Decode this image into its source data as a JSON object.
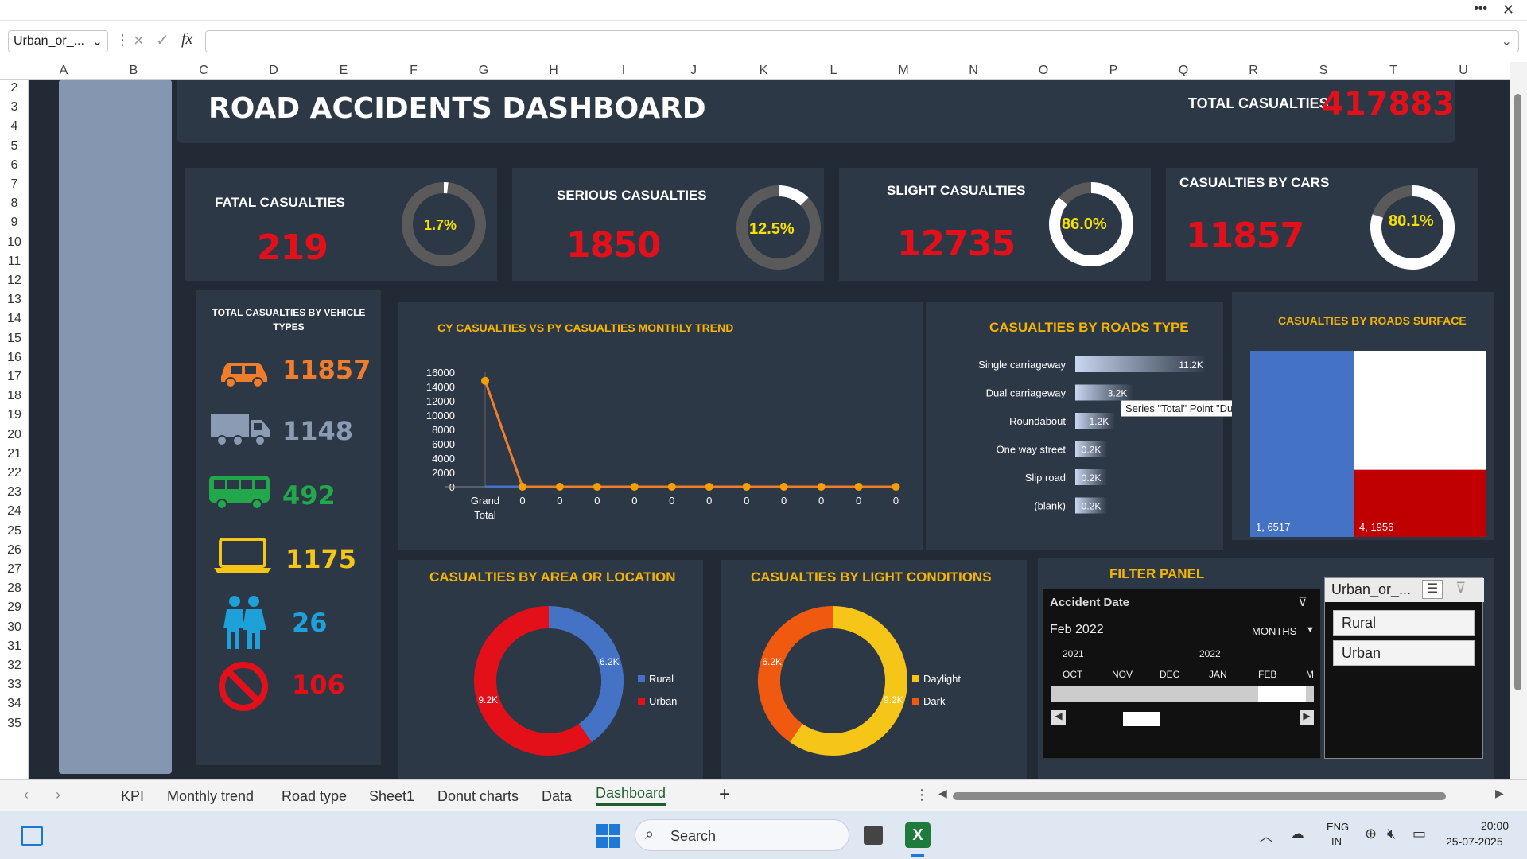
{
  "window": {
    "more": "•••",
    "close": "✕"
  },
  "formula": {
    "namebox": "Urban_or_...",
    "fx": "fx"
  },
  "columns": [
    "A",
    "B",
    "C",
    "D",
    "E",
    "F",
    "G",
    "H",
    "I",
    "J",
    "K",
    "L",
    "M",
    "N",
    "O",
    "P",
    "Q",
    "R",
    "S",
    "T",
    "U"
  ],
  "rows": [
    "2",
    "3",
    "4",
    "5",
    "6",
    "7",
    "8",
    "9",
    "10",
    "11",
    "12",
    "13",
    "14",
    "15",
    "16",
    "17",
    "18",
    "19",
    "20",
    "21",
    "22",
    "23",
    "24",
    "25",
    "26",
    "27",
    "28",
    "29",
    "30",
    "31",
    "32",
    "33",
    "34",
    "35"
  ],
  "header": {
    "title": "ROAD ACCIDENTS DASHBOARD",
    "total_label": "TOTAL CASUALTIES",
    "total_value": "417883"
  },
  "kpis": [
    {
      "title": "FATAL CASUALTIES",
      "value": "219",
      "pct_label": "1.7%",
      "pct": 0.017
    },
    {
      "title": "SERIOUS CASUALTIES",
      "value": "1850",
      "pct_label": "12.5%",
      "pct": 0.125
    },
    {
      "title": "SLIGHT CASUALTIES",
      "value": "12735",
      "pct_label": "86.0%",
      "pct": 0.86
    },
    {
      "title": "CASUALTIES BY CARS",
      "value": "11857",
      "pct_label": "80.1%",
      "pct": 0.801
    }
  ],
  "vehicles": {
    "title": "TOTAL CASUALTIES BY VEHICLE TYPES",
    "items": [
      {
        "icon": "car-icon",
        "value": "11857",
        "color": "#f07d2b"
      },
      {
        "icon": "truck-icon",
        "value": "1148",
        "color": "#8a9bb3"
      },
      {
        "icon": "bus-icon",
        "value": "492",
        "color": "#22a84a"
      },
      {
        "icon": "laptop-icon",
        "value": "1175",
        "color": "#f5c518"
      },
      {
        "icon": "people-icon",
        "value": "26",
        "color": "#1ea0d8"
      },
      {
        "icon": "no-entry-icon",
        "value": "106",
        "color": "#e3101a"
      }
    ]
  },
  "trend_chart": {
    "title": "CY CASUALTIES VS PY CASUALTIES MONTHLY TREND",
    "chart_data": {
      "type": "line",
      "categories": [
        "Grand Total",
        "0",
        "0",
        "0",
        "0",
        "0",
        "0",
        "0",
        "0",
        "0",
        "0",
        "0"
      ],
      "series": [
        {
          "values": [
            14800,
            0,
            0,
            0,
            0,
            0,
            0,
            0,
            0,
            0,
            0,
            0
          ]
        }
      ],
      "yticks": [
        "16000",
        "14000",
        "12000",
        "10000",
        "8000",
        "6000",
        "4000",
        "2000",
        "0"
      ],
      "ylim": [
        0,
        16000
      ]
    }
  },
  "road_type": {
    "title": "CASUALTIES  BY ROADS TYPE",
    "chart_data": {
      "type": "bar",
      "categories": [
        "Single carriageway",
        "Dual carriageway",
        "Roundabout",
        "One way street",
        "Slip road",
        "(blank)"
      ],
      "values": [
        11200,
        3200,
        1200,
        200,
        200,
        200
      ],
      "labels": [
        "11.2K",
        "3.2K",
        "1.2K",
        "0.2K",
        "0.2K",
        "0.2K"
      ]
    },
    "tooltip": "Series \"Total\" Point \"Dual carriageway\" Data Label"
  },
  "road_surface": {
    "title": "CASUALTIES  BY ROADS SURFACE",
    "chart_data": {
      "type": "bar",
      "series": [
        {
          "label": "1, 6517",
          "value": 6517,
          "color": "#4472c4"
        },
        {
          "label": "4, 1956",
          "value": 1956,
          "color": "#c00000"
        }
      ]
    }
  },
  "area_chart": {
    "title": "CASUALTIES  BY AREA OR LOCATION",
    "chart_data": {
      "type": "pie",
      "slices": [
        {
          "name": "Rural",
          "value": 6.2,
          "label": "6.2K",
          "color": "#4472c4"
        },
        {
          "name": "Urban",
          "value": 9.2,
          "label": "9.2K",
          "color": "#e3101a"
        }
      ]
    }
  },
  "light_chart": {
    "title": "CASUALTIES  BY LIGHT CONDITIONS",
    "chart_data": {
      "type": "pie",
      "slices": [
        {
          "name": "Daylight",
          "value": 9.2,
          "label": "9.2K",
          "color": "#f5c518"
        },
        {
          "name": "Dark",
          "value": 6.2,
          "label": "6.2K",
          "color": "#f05a10"
        }
      ]
    }
  },
  "filter": {
    "title": "FILTER PANEL",
    "timeline": {
      "header": "Accident Date",
      "selected": "Feb 2022",
      "level": "MONTHS",
      "years": [
        "2021",
        "2022"
      ],
      "months": [
        "OCT",
        "NOV",
        "DEC",
        "JAN",
        "FEB",
        "M"
      ]
    },
    "slicer": {
      "header": "Urban_or_...",
      "items": [
        "Rural",
        "Urban"
      ]
    }
  },
  "tabs": [
    "KPI",
    "Monthly trend",
    "Road type",
    "Sheet1",
    "Donut charts",
    "Data",
    "Dashboard"
  ],
  "active_tab": "Dashboard",
  "taskbar": {
    "search": "Search",
    "lang1": "ENG",
    "lang2": "IN",
    "time": "20:00",
    "date": "25-07-2025"
  }
}
